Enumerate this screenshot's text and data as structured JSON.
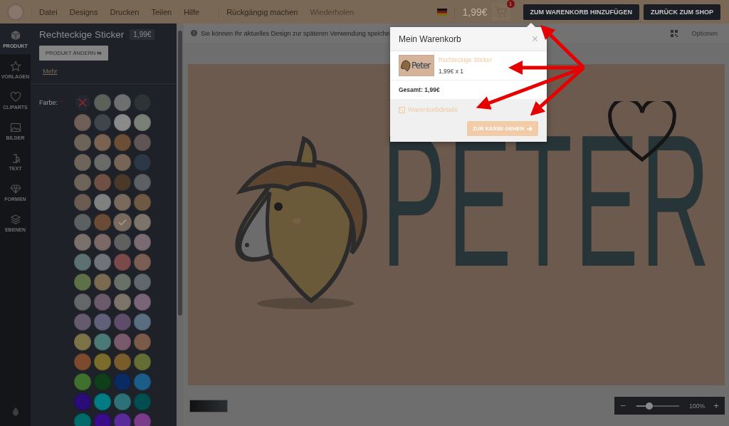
{
  "menu": [
    {
      "label": "Datei"
    },
    {
      "label": "Designs"
    },
    {
      "label": "Drucken"
    },
    {
      "label": "Teilen"
    },
    {
      "label": "Hilfe"
    }
  ],
  "history": [
    {
      "label": "Rückgängig machen",
      "disabled": false
    },
    {
      "label": "Wiederholen",
      "disabled": true
    }
  ],
  "header": {
    "price": "1,99€",
    "cart_count": "1",
    "buttons": [
      "ZUM WARENKORB HINZUFÜGEN",
      "ZURÜCK ZUM SHOP"
    ]
  },
  "rail": [
    {
      "label": "PRODUKT",
      "kind": "cube",
      "selected": true
    },
    {
      "label": "VORLAGEN",
      "kind": "star",
      "selected": false
    },
    {
      "label": "CLIPARTS",
      "kind": "heart",
      "selected": false
    },
    {
      "label": "BILDER",
      "kind": "image",
      "selected": false
    },
    {
      "label": "TEXT",
      "kind": "text",
      "selected": false
    },
    {
      "label": "FORMEN",
      "kind": "diamond",
      "selected": false
    },
    {
      "label": "EBENEN",
      "kind": "layers",
      "selected": false
    }
  ],
  "panel": {
    "title": "Rechteckige Sticker",
    "price": "1,99€",
    "change_button": "PRODUKT ÄNDERN ⇆",
    "more_link": "Mehr",
    "color_label": "Farbe:",
    "required_mark": "*",
    "swatches": [
      {
        "kind": "none",
        "selected": false
      },
      {
        "color": "#5e605c",
        "selected": false
      },
      {
        "color": "#6e706f",
        "selected": false
      },
      {
        "color": "#2e3436",
        "selected": false
      },
      {
        "color": "#6e6059",
        "selected": false
      },
      {
        "color": "#3e454b",
        "selected": false
      },
      {
        "color": "#8a8a8a",
        "selected": false
      },
      {
        "color": "#7a8078",
        "selected": false
      },
      {
        "color": "#6d6459",
        "selected": false
      },
      {
        "color": "#7a6252",
        "selected": false
      },
      {
        "color": "#6a4e36",
        "selected": false
      },
      {
        "color": "#605454",
        "selected": false
      },
      {
        "color": "#6d655c",
        "selected": false
      },
      {
        "color": "#6a6a68",
        "selected": false
      },
      {
        "color": "#766556",
        "selected": false
      },
      {
        "color": "#2c3846",
        "selected": false
      },
      {
        "color": "#6d645a",
        "selected": false
      },
      {
        "color": "#6e5044",
        "selected": false
      },
      {
        "color": "#4a3828",
        "selected": false
      },
      {
        "color": "#5c6062",
        "selected": false
      },
      {
        "color": "#6a5c52",
        "selected": false
      },
      {
        "color": "#808080",
        "selected": false
      },
      {
        "color": "#7a6a5e",
        "selected": false
      },
      {
        "color": "#6e5a44",
        "selected": false
      },
      {
        "color": "#5c6062",
        "selected": false
      },
      {
        "color": "#6a4c36",
        "selected": false
      },
      {
        "color": "#7a6a5e",
        "selected": true
      },
      {
        "color": "#7c746a",
        "selected": false
      },
      {
        "color": "#7a706c",
        "selected": false
      },
      {
        "color": "#7c6866",
        "selected": false
      },
      {
        "color": "#606060",
        "selected": false
      },
      {
        "color": "#7a6a72",
        "selected": false
      },
      {
        "color": "#5c7270",
        "selected": false
      },
      {
        "color": "#6e747a",
        "selected": false
      },
      {
        "color": "#7a4a4a",
        "selected": false
      },
      {
        "color": "#7a5e54",
        "selected": false
      },
      {
        "color": "#5e7048",
        "selected": false
      },
      {
        "color": "#7a6a52",
        "selected": false
      },
      {
        "color": "#687068",
        "selected": false
      },
      {
        "color": "#60686e",
        "selected": false
      },
      {
        "color": "#64666a",
        "selected": false
      },
      {
        "color": "#6a5a6c",
        "selected": false
      },
      {
        "color": "#7c7468",
        "selected": false
      },
      {
        "color": "#7a6478",
        "selected": false
      },
      {
        "color": "#665a6e",
        "selected": false
      },
      {
        "color": "#60607a",
        "selected": false
      },
      {
        "color": "#5e4c6a",
        "selected": false
      },
      {
        "color": "#5a6e82",
        "selected": false
      },
      {
        "color": "#7c7448",
        "selected": false
      },
      {
        "color": "#4c7878",
        "selected": false
      },
      {
        "color": "#7a5a6a",
        "selected": false
      },
      {
        "color": "#7a5a48",
        "selected": false
      },
      {
        "color": "#7c4a2c",
        "selected": false
      },
      {
        "color": "#7c6c2c",
        "selected": false
      },
      {
        "color": "#7a5c2c",
        "selected": false
      },
      {
        "color": "#646e34",
        "selected": false
      },
      {
        "color": "#40702e",
        "selected": false
      },
      {
        "color": "#0e3e1a",
        "selected": false
      },
      {
        "color": "#0a2a62",
        "selected": false
      },
      {
        "color": "#1c5c88",
        "selected": false
      },
      {
        "color": "#2a0c78",
        "selected": false
      },
      {
        "color": "#007c84",
        "selected": false
      },
      {
        "color": "#2c7078",
        "selected": false
      },
      {
        "color": "#004e50",
        "selected": false
      },
      {
        "color": "#006a6a",
        "selected": false
      },
      {
        "color": "#3a0c8a",
        "selected": false
      },
      {
        "color": "#5a2a9a",
        "selected": false
      },
      {
        "color": "#7a3c8a",
        "selected": false
      }
    ]
  },
  "info_text": "Sie können Ihr aktuelles Design zur späteren Verwendung speiche",
  "options_label": "Optionen",
  "design": {
    "text": "PETER"
  },
  "zoom": {
    "minus": "−",
    "level": 0.3,
    "reading": "100%",
    "plus": "+"
  },
  "cart_popup": {
    "title": "Mein Warenkorb",
    "close": "×",
    "item_name": "Rechteckige Sticker",
    "thumbnail_text": "Peter",
    "item_price": "1,99€ x 1",
    "total": "Gesamt: 1,99€",
    "details_link": "Warenkorbdetails",
    "checkout_button": "ZUR KASSE GEHEN"
  }
}
